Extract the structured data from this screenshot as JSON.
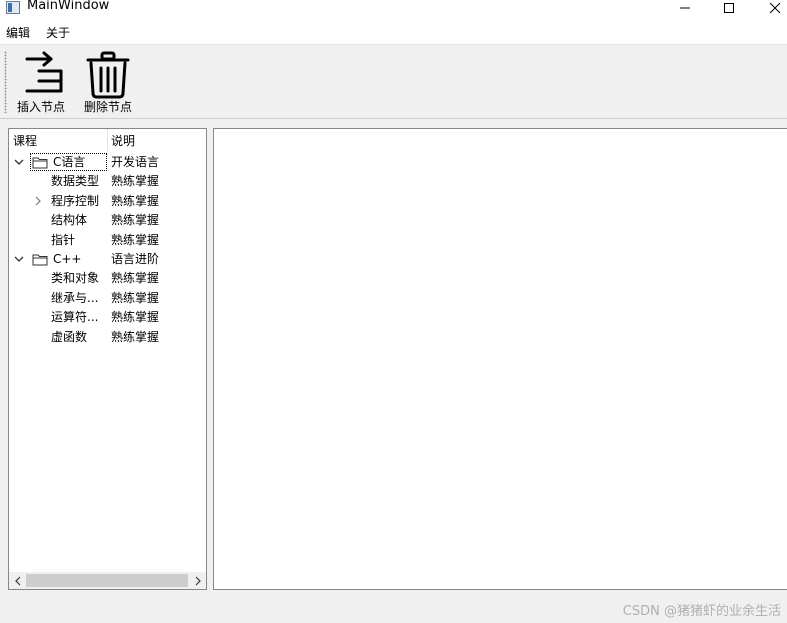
{
  "window": {
    "title": "MainWindow"
  },
  "menu": {
    "items": [
      "编辑",
      "关于"
    ]
  },
  "toolbar": {
    "insert_label": "插入节点",
    "delete_label": "删除节点"
  },
  "tree": {
    "headers": [
      "课程",
      "说明"
    ],
    "rows": [
      {
        "name": "C语言",
        "desc": "开发语言",
        "level": 0,
        "arrow": "expanded",
        "folder": true,
        "current": true
      },
      {
        "name": "数据类型",
        "desc": "熟练掌握",
        "level": 1,
        "arrow": "none"
      },
      {
        "name": "程序控制",
        "desc": "熟练掌握",
        "level": 1,
        "arrow": "collapsed"
      },
      {
        "name": "结构体",
        "desc": "熟练掌握",
        "level": 1,
        "arrow": "none"
      },
      {
        "name": "指针",
        "desc": "熟练掌握",
        "level": 1,
        "arrow": "none"
      },
      {
        "name": "C++",
        "desc": "语言进阶",
        "level": 0,
        "arrow": "expanded",
        "folder": true
      },
      {
        "name": "类和对象",
        "desc": "熟练掌握",
        "level": 1,
        "arrow": "none"
      },
      {
        "name": "继承与...",
        "desc": "熟练掌握",
        "level": 1,
        "arrow": "none"
      },
      {
        "name": "运算符...",
        "desc": "熟练掌握",
        "level": 1,
        "arrow": "none"
      },
      {
        "name": "虚函数",
        "desc": "熟练掌握",
        "level": 1,
        "arrow": "none"
      }
    ]
  },
  "watermark": "CSDN @猪猪虾的业余生活"
}
